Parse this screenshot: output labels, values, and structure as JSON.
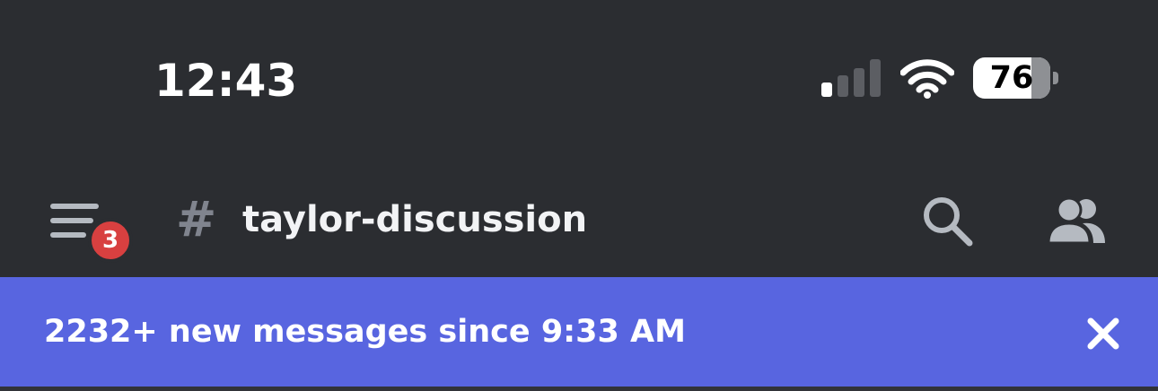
{
  "status_bar": {
    "time": "12:43",
    "signal_bars_active": 1,
    "signal_bars_total": 4,
    "battery_percent": "76",
    "battery_level": 0.76
  },
  "header": {
    "menu_badge_count": "3",
    "channel_prefix": "#",
    "channel_name": "taylor-discussion",
    "icons": [
      "hamburger-menu-icon",
      "search-icon",
      "members-icon"
    ]
  },
  "new_messages_bar": {
    "text": "2232+ new messages since 9:33 AM",
    "close_icon": "close-icon"
  },
  "colors": {
    "background": "#2b2d31",
    "accent": "#5865e0",
    "badge": "#d84040",
    "icon_muted": "#b5bac1"
  }
}
